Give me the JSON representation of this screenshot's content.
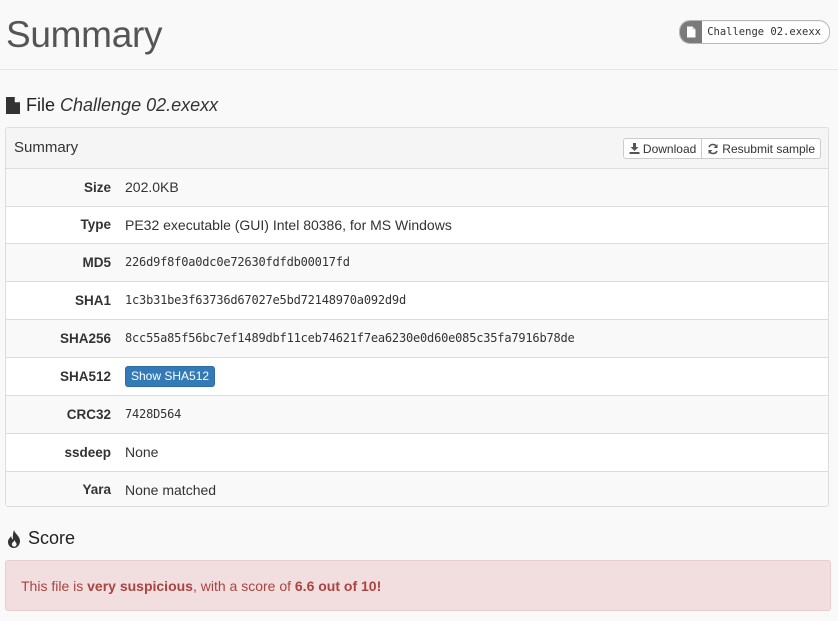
{
  "header": {
    "title": "Summary",
    "file_pill": "Challenge 02.exexx"
  },
  "file_section": {
    "label": "File",
    "file_name": "Challenge 02.exexx"
  },
  "summary_panel": {
    "title": "Summary",
    "download_label": "Download",
    "resubmit_label": "Resubmit sample",
    "rows": {
      "size": {
        "label": "Size",
        "value": "202.0KB"
      },
      "type": {
        "label": "Type",
        "value": "PE32 executable (GUI) Intel 80386, for MS Windows"
      },
      "md5": {
        "label": "MD5",
        "value": "226d9f8f0a0dc0e72630fdfdb00017fd"
      },
      "sha1": {
        "label": "SHA1",
        "value": "1c3b31be3f63736d67027e5bd72148970a092d9d"
      },
      "sha256": {
        "label": "SHA256",
        "value": "8cc55a85f56bc7ef1489dbf11ceb74621f7ea6230e0d60e085c35fa7916b78de"
      },
      "sha512": {
        "label": "SHA512",
        "button": "Show SHA512"
      },
      "crc32": {
        "label": "CRC32",
        "value": "7428D564"
      },
      "ssdeep": {
        "label": "ssdeep",
        "value": "None"
      },
      "yara": {
        "label": "Yara",
        "value": "None matched"
      }
    }
  },
  "score_section": {
    "label": "Score",
    "alert": {
      "prefix": "This file is ",
      "verdict": "very suspicious",
      "middle": ", with a score of ",
      "score": "6.6 out of 10!"
    }
  },
  "colors": {
    "primary_button": "#337ab7",
    "alert_bg": "#f2dede",
    "alert_text": "#a94442"
  }
}
